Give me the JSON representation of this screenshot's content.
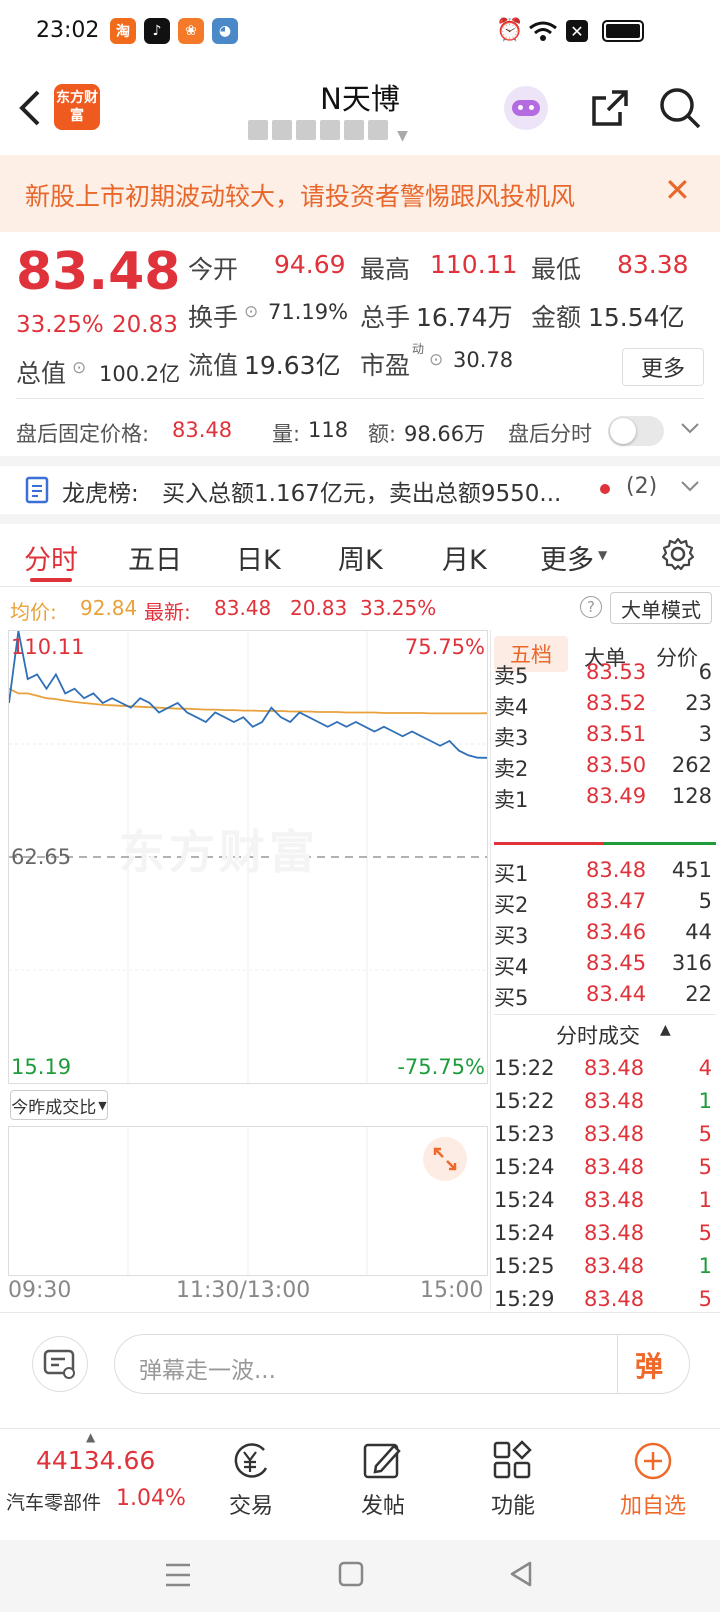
{
  "status": {
    "time": "23:02"
  },
  "header": {
    "title": "N天博",
    "subtitle_masked": "",
    "back_icon": "chevron-left-icon",
    "logo_text": "东方财富"
  },
  "banner": {
    "text": "新股上市初期波动较大，请投资者警惕跟风投机风",
    "close": "✕"
  },
  "quote": {
    "price": "83.48",
    "change_pct": "33.25%",
    "change": "20.83",
    "open_label": "今开",
    "open": "94.69",
    "high_label": "最高",
    "high": "110.11",
    "low_label": "最低",
    "low": "83.38",
    "turnover_label": "换手",
    "turnover": "71.19%",
    "volume_label": "总手",
    "volume": "16.74万",
    "amount_label": "金额",
    "amount": "15.54亿",
    "mktcap_label": "总值",
    "mktcap": "100.2亿",
    "float_label": "流值",
    "float": "19.63亿",
    "pe_label": "市盈",
    "pe_sup": "动",
    "pe": "30.78",
    "more_button": "更多"
  },
  "after_hours": {
    "fixed_label": "盘后固定价格:",
    "fixed_price": "83.48",
    "vol_label": "量:",
    "vol": "118",
    "amt_label": "额:",
    "amt": "98.66万",
    "timeshare_label": "盘后分时"
  },
  "dragon": {
    "label": "龙虎榜:",
    "text": "买入总额1.167亿元，卖出总额9550...",
    "count": "(2)"
  },
  "tabs": [
    "分时",
    "五日",
    "日K",
    "周K",
    "月K",
    "更多"
  ],
  "chart_header": {
    "avg_label": "均价:",
    "avg": "92.84",
    "latest_label": "最新:",
    "latest": "83.48",
    "change": "20.83",
    "pct": "33.25%",
    "mode_button": "大单模式"
  },
  "chart_labels": {
    "top_left": "110.11",
    "top_right": "75.75%",
    "mid": "62.65",
    "bottom_left": "15.19",
    "bottom_right": "-75.75%",
    "watermark": "东方财富",
    "sub_dropdown": "今昨成交比",
    "time_start": "09:30",
    "time_mid": "11:30/13:00",
    "time_end": "15:00"
  },
  "chart_data": {
    "type": "line",
    "ylim": [
      15.19,
      110.11
    ],
    "series": [
      {
        "values": [
          95,
          110.1,
          100,
          101,
          98,
          101,
          97,
          98,
          96,
          97,
          95,
          96,
          95,
          94,
          96,
          95,
          93,
          94,
          95,
          93,
          92,
          91,
          93,
          92,
          91,
          92,
          90,
          91,
          94,
          92,
          91,
          93,
          92,
          91,
          90,
          91,
          90,
          91,
          90,
          89,
          90,
          89,
          88,
          89,
          88,
          87,
          86,
          87,
          85,
          84,
          83.5,
          83.48
        ]
      },
      {
        "values": [
          98,
          97,
          97,
          96.5,
          96,
          95.8,
          95.5,
          95.2,
          95,
          94.8,
          94.6,
          94.5,
          94.4,
          94.3,
          94.2,
          94.1,
          94,
          93.9,
          93.8,
          93.8,
          93.7,
          93.6,
          93.6,
          93.5,
          93.5,
          93.4,
          93.4,
          93.3,
          93.3,
          93.3,
          93.2,
          93.2,
          93.2,
          93.1,
          93.1,
          93.1,
          93,
          93,
          93,
          93,
          92.9,
          92.9,
          92.9,
          92.9,
          92.9,
          92.8,
          92.8,
          92.8,
          92.8,
          92.8,
          92.8,
          92.84
        ]
      }
    ],
    "colors": {
      "price": "#2e6fb7",
      "avg": "#e9a13b"
    }
  },
  "orderbook": {
    "tabs": [
      "五档",
      "大单",
      "分价"
    ],
    "asks": [
      {
        "label": "卖5",
        "price": "83.53",
        "vol": "6"
      },
      {
        "label": "卖4",
        "price": "83.52",
        "vol": "23"
      },
      {
        "label": "卖3",
        "price": "83.51",
        "vol": "3"
      },
      {
        "label": "卖2",
        "price": "83.50",
        "vol": "262"
      },
      {
        "label": "卖1",
        "price": "83.49",
        "vol": "128"
      }
    ],
    "bids": [
      {
        "label": "买1",
        "price": "83.48",
        "vol": "451"
      },
      {
        "label": "买2",
        "price": "83.47",
        "vol": "5"
      },
      {
        "label": "买3",
        "price": "83.46",
        "vol": "44"
      },
      {
        "label": "买4",
        "price": "83.45",
        "vol": "316"
      },
      {
        "label": "买5",
        "price": "83.44",
        "vol": "22"
      }
    ],
    "trades_title": "分时成交",
    "trades": [
      {
        "time": "15:22",
        "price": "83.48",
        "vol": "4",
        "side": "buy"
      },
      {
        "time": "15:22",
        "price": "83.48",
        "vol": "1",
        "side": "sell"
      },
      {
        "time": "15:23",
        "price": "83.48",
        "vol": "5",
        "side": "buy"
      },
      {
        "time": "15:24",
        "price": "83.48",
        "vol": "5",
        "side": "buy"
      },
      {
        "time": "15:24",
        "price": "83.48",
        "vol": "1",
        "side": "buy"
      },
      {
        "time": "15:24",
        "price": "83.48",
        "vol": "5",
        "side": "buy"
      },
      {
        "time": "15:25",
        "price": "83.48",
        "vol": "1",
        "side": "sell"
      },
      {
        "time": "15:29",
        "price": "83.48",
        "vol": "5",
        "side": "buy"
      }
    ]
  },
  "comment": {
    "placeholder": "弹幕走一波...",
    "danmu_button": "弹"
  },
  "bottom": {
    "index_value": "44134.66",
    "index_name": "汽车零部件",
    "index_pct": "1.04%",
    "items": [
      "交易",
      "发帖",
      "功能",
      "加自选"
    ]
  }
}
